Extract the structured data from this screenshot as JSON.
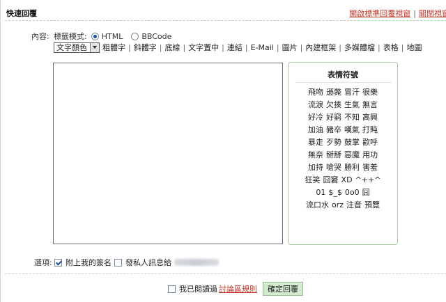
{
  "header": {
    "title": "快速回覆",
    "link_standard": "開啟標準回覆視窗",
    "separator": "|",
    "link_close": "關閉視窗"
  },
  "form": {
    "content_label": "內容:",
    "mode_label": "標籤模式:",
    "mode_html": "HTML",
    "mode_bbcode": "BBCode",
    "mode_selected": "HTML",
    "color_select": "文字顏色",
    "editor_value": ""
  },
  "toolbar": {
    "items": [
      "粗體字",
      "斜體字",
      "底線",
      "文字置中",
      "連結",
      "E-Mail",
      "圖片",
      "內建框架",
      "多媒體檔",
      "表格",
      "地圖"
    ],
    "separator": "|"
  },
  "emoticons": {
    "title": "表情符號",
    "rows": [
      [
        "飛吻",
        "遜斃",
        "冒汗",
        "很樂"
      ],
      [
        "流淚",
        "欠揍",
        "生氣",
        "無言"
      ],
      [
        "好冷",
        "好窮",
        "不知",
        "高興"
      ],
      [
        "加油",
        "豬卒",
        "嘆氣",
        "打盹"
      ],
      [
        "暴走",
        "歹勢",
        "鼓掌",
        "歡呼"
      ],
      [
        "無奈",
        "掰掰",
        "惡魔",
        "用功"
      ],
      [
        "加持",
        "嗆哭",
        "勝利",
        "害羞"
      ],
      [
        "狂笑",
        "囧窘",
        "XD",
        "^++^"
      ],
      [
        "01",
        "$_$",
        "0o0",
        "囧"
      ],
      [
        "流口水",
        "orz",
        "注音",
        "預覽"
      ]
    ]
  },
  "options": {
    "label": "選項:",
    "attach_signature": "附上我的簽名",
    "attach_signature_checked": true,
    "send_pm": "發私人訊息給",
    "send_pm_checked": false
  },
  "footer": {
    "agree_text": "我已閱讀過",
    "rules_link": "討論區規則",
    "agree_checked": false,
    "submit_label": "確定回覆"
  },
  "colors": {
    "accent_link": "#c0392b",
    "border_green": "#a9cf9f",
    "button_bg": "#d4ebd0"
  }
}
